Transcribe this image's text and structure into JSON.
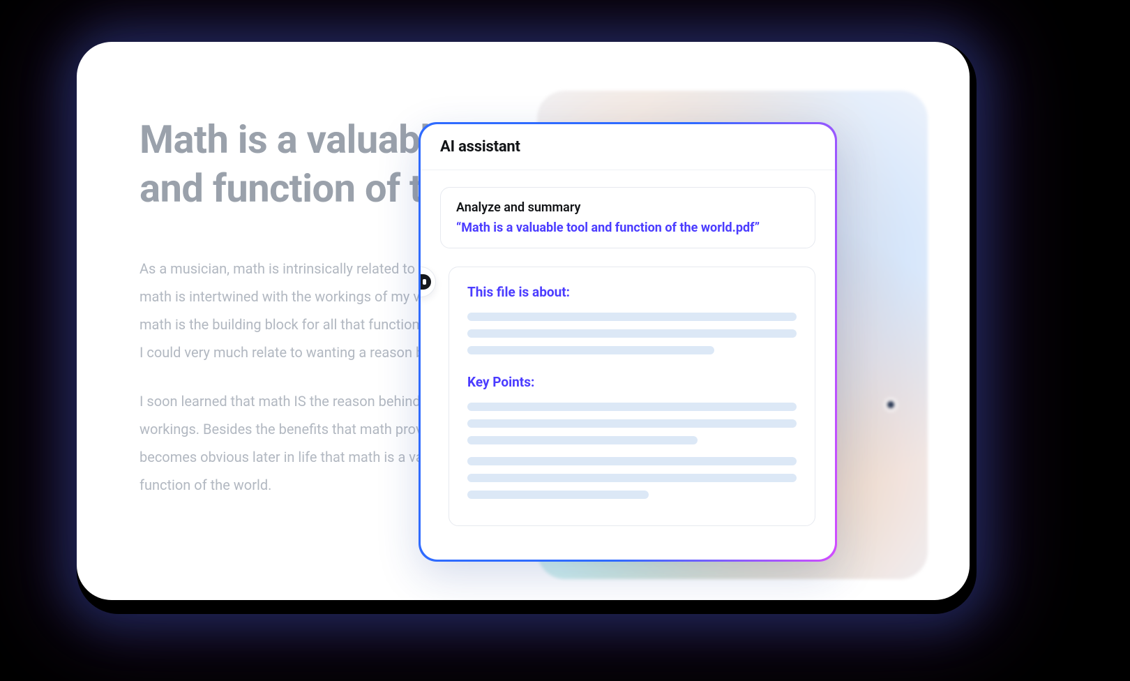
{
  "document": {
    "title": "Math is a valuable tool and function of the world",
    "paragraphs": [
      "As a musician, math is intrinsically related to my craft. As a sailor, math is intertwined with the workings of my vessel. As a human, math is the building block for all that functions. When I was a child, I could very much relate to wanting a reason behind math.",
      "I soon learned that math IS the reason behind all of the world's workings. Besides the benefits that math provides to one's career, it becomes obvious later in life that math is a valuable tool and function of the world."
    ]
  },
  "assistant": {
    "panel_title": "AI assistant",
    "prompt_label": "Analyze and summary",
    "prompt_file": "“Math is a valuable tool and function of the world.pdf”",
    "response": {
      "section1_heading": "This file is about:",
      "section2_heading": "Key Points:"
    }
  }
}
